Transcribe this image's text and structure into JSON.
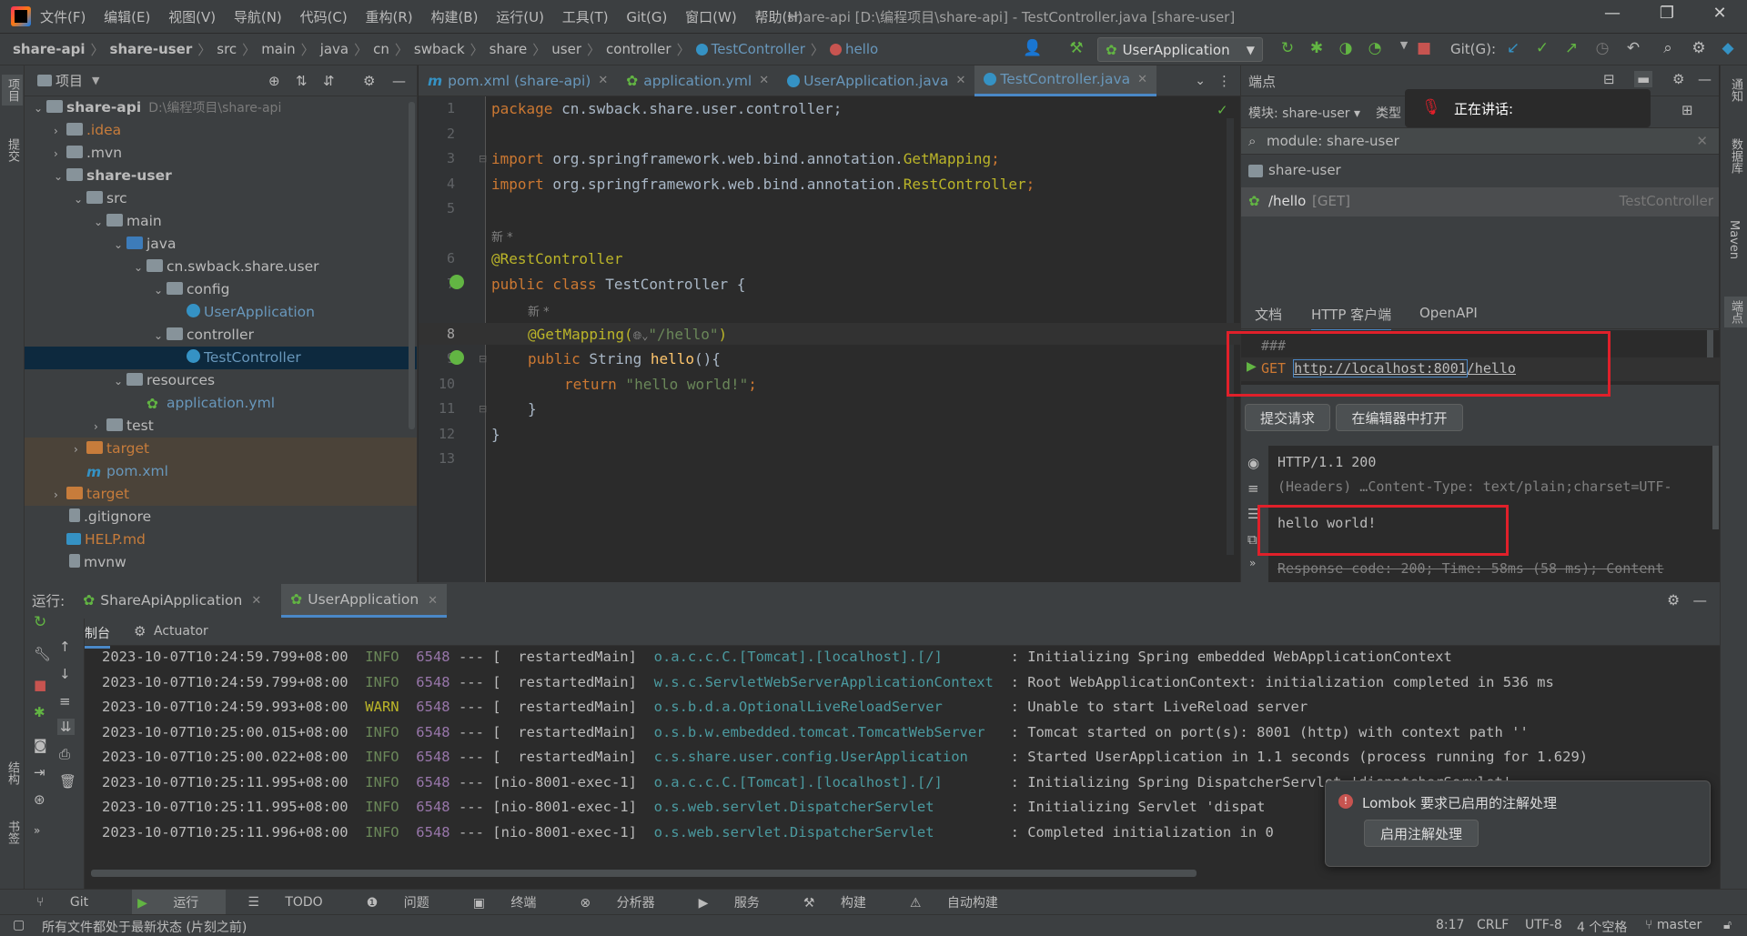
{
  "titlebar": {
    "menus": [
      "文件(F)",
      "编辑(E)",
      "视图(V)",
      "导航(N)",
      "代码(C)",
      "重构(R)",
      "构建(B)",
      "运行(U)",
      "工具(T)",
      "Git(G)",
      "窗口(W)",
      "帮助(H)"
    ],
    "title": "share-api [D:\\编程项目\\share-api] - TestController.java [share-user]"
  },
  "breadcrumbs": [
    "share-api",
    "share-user",
    "src",
    "main",
    "java",
    "cn",
    "swback",
    "share",
    "user",
    "controller",
    "TestController",
    "hello"
  ],
  "toolbar": {
    "run_config": "UserApplication",
    "git_label": "Git(G):"
  },
  "left_strip": {
    "project": "项目",
    "commit": "提交",
    "structure": "结构",
    "bookmarks": "书签"
  },
  "project": {
    "title": "项目",
    "tree": [
      {
        "label": "share-api",
        "hint": "D:\\编程项目\\share-api",
        "depth": 0,
        "arrow": "v",
        "icon": "folder",
        "bold": true
      },
      {
        "label": ".idea",
        "depth": 1,
        "arrow": ">",
        "icon": "folder",
        "color": "#c77c3b"
      },
      {
        "label": ".mvn",
        "depth": 1,
        "arrow": ">",
        "icon": "folder"
      },
      {
        "label": "share-user",
        "depth": 1,
        "arrow": "v",
        "icon": "folder",
        "bold": true
      },
      {
        "label": "src",
        "depth": 2,
        "arrow": "v",
        "icon": "folder"
      },
      {
        "label": "main",
        "depth": 3,
        "arrow": "v",
        "icon": "folder"
      },
      {
        "label": "java",
        "depth": 4,
        "arrow": "v",
        "icon": "folder-blue"
      },
      {
        "label": "cn.swback.share.user",
        "depth": 5,
        "arrow": "v",
        "icon": "folder"
      },
      {
        "label": "config",
        "depth": 6,
        "arrow": "v",
        "icon": "folder"
      },
      {
        "label": "UserApplication",
        "depth": 7,
        "arrow": "",
        "icon": "spring-class",
        "color": "#6897bb"
      },
      {
        "label": "controller",
        "depth": 6,
        "arrow": "v",
        "icon": "folder"
      },
      {
        "label": "TestController",
        "depth": 7,
        "arrow": "",
        "icon": "class",
        "color": "#6897bb",
        "selected": true
      },
      {
        "label": "resources",
        "depth": 4,
        "arrow": "v",
        "icon": "folder"
      },
      {
        "label": "application.yml",
        "depth": 5,
        "arrow": "",
        "icon": "yml",
        "color": "#6897bb"
      },
      {
        "label": "test",
        "depth": 3,
        "arrow": ">",
        "icon": "folder"
      },
      {
        "label": "target",
        "depth": 2,
        "arrow": ">",
        "icon": "folder-orange",
        "color": "#c77c3b",
        "excluded": true
      },
      {
        "label": "pom.xml",
        "depth": 2,
        "arrow": "",
        "icon": "maven",
        "color": "#6897bb",
        "excluded": true
      },
      {
        "label": "target",
        "depth": 1,
        "arrow": ">",
        "icon": "folder-orange",
        "color": "#c77c3b",
        "excluded": true
      },
      {
        "label": ".gitignore",
        "depth": 1,
        "arrow": "",
        "icon": "file"
      },
      {
        "label": "HELP.md",
        "depth": 1,
        "arrow": "",
        "icon": "md",
        "color": "#c77c3b"
      },
      {
        "label": "mvnw",
        "depth": 1,
        "arrow": "",
        "icon": "file"
      }
    ]
  },
  "tabs": [
    {
      "label": "pom.xml (share-api)",
      "icon": "maven"
    },
    {
      "label": "application.yml",
      "icon": "yml"
    },
    {
      "label": "UserApplication.java",
      "icon": "spring-class"
    },
    {
      "label": "TestController.java",
      "icon": "class",
      "active": true
    }
  ],
  "editor": {
    "lines": [
      "1",
      "2",
      "3",
      "4",
      "5",
      "6",
      "7",
      "8",
      "9",
      "10",
      "11",
      "12",
      "13"
    ],
    "hint_new": "新 *",
    "code": {
      "l1_kw": "package",
      "l1_rest": " cn.swback.share.user.controller;",
      "l3_kw": "import",
      "l3_pkg": " org.springframework.web.bind.annotation.",
      "l3_cls": "GetMapping",
      "l3_end": ";",
      "l4_kw": "import",
      "l4_pkg": " org.springframework.web.bind.annotation.",
      "l4_cls": "RestController",
      "l4_end": ";",
      "l6": "@RestController",
      "l7_kw": "public class",
      "l7_rest": " TestController {",
      "l8_ann": "@GetMapping(",
      "l8_str": "\"/hello\"",
      "l8_end": ")",
      "l9_kw": "public",
      "l9_type": " String ",
      "l9_fn": "hello",
      "l9_end": "(){",
      "l10_kw": "return",
      "l10_str": " \"hello world!\"",
      "l10_end": ";",
      "l11": "}",
      "l12": "}"
    }
  },
  "endpoints": {
    "title": "端点",
    "module_filter": "模块: share-user",
    "type_filter": "类型",
    "search_value": "module: share-user",
    "module_item": "share-user",
    "endpoint_path": "/hello",
    "endpoint_method": "[GET]",
    "endpoint_class": "TestController",
    "tabs": [
      "文档",
      "HTTP 客户端",
      "OpenAPI"
    ],
    "http_comment": "###",
    "http_method": "GET",
    "http_host": "http://localhost:8001",
    "http_path": "/hello",
    "submit_button": "提交请求",
    "open_editor_button": "在编辑器中打开",
    "response_status": "HTTP/1.1 200",
    "response_headers": "(Headers) …Content-Type: text/plain;charset=UTF-",
    "response_body": "hello world!",
    "response_footer": "Response code: 200; Time: 58ms (58 ms); Content"
  },
  "speaking_popup": {
    "label": "正在讲话:"
  },
  "run": {
    "label": "运行:",
    "tabs": [
      "ShareApiApplication",
      "UserApplication"
    ],
    "subtabs": [
      "控制台",
      "Actuator"
    ],
    "log": [
      {
        "ts": "2023-10-07T10:24:59.799+08:00",
        "level": "INFO",
        "pid": "6548",
        "thread": "[  restartedMain]",
        "logger": "o.a.c.c.C.[Tomcat].[localhost].[/]      ",
        "msg": ": Initializing Spring embedded WebApplicationContext"
      },
      {
        "ts": "2023-10-07T10:24:59.799+08:00",
        "level": "INFO",
        "pid": "6548",
        "thread": "[  restartedMain]",
        "logger": "w.s.c.ServletWebServerApplicationContext",
        "msg": ": Root WebApplicationContext: initialization completed in 536 ms"
      },
      {
        "ts": "2023-10-07T10:24:59.993+08:00",
        "level": "WARN",
        "pid": "6548",
        "thread": "[  restartedMain]",
        "logger": "o.s.b.d.a.OptionalLiveReloadServer      ",
        "msg": ": Unable to start LiveReload server"
      },
      {
        "ts": "2023-10-07T10:25:00.015+08:00",
        "level": "INFO",
        "pid": "6548",
        "thread": "[  restartedMain]",
        "logger": "o.s.b.w.embedded.tomcat.TomcatWebServer ",
        "msg": ": Tomcat started on port(s): 8001 (http) with context path ''"
      },
      {
        "ts": "2023-10-07T10:25:00.022+08:00",
        "level": "INFO",
        "pid": "6548",
        "thread": "[  restartedMain]",
        "logger": "c.s.share.user.config.UserApplication   ",
        "msg": ": Started UserApplication in 1.1 seconds (process running for 1.629)"
      },
      {
        "ts": "2023-10-07T10:25:11.995+08:00",
        "level": "INFO",
        "pid": "6548",
        "thread": "[nio-8001-exec-1]",
        "logger": "o.a.c.c.C.[Tomcat].[localhost].[/]      ",
        "msg": ": Initializing Spring DispatcherServlet 'dispatcherServlet'"
      },
      {
        "ts": "2023-10-07T10:25:11.995+08:00",
        "level": "INFO",
        "pid": "6548",
        "thread": "[nio-8001-exec-1]",
        "logger": "o.s.web.servlet.DispatcherServlet       ",
        "msg": ": Initializing Servlet 'dispat"
      },
      {
        "ts": "2023-10-07T10:25:11.996+08:00",
        "level": "INFO",
        "pid": "6548",
        "thread": "[nio-8001-exec-1]",
        "logger": "o.s.web.servlet.DispatcherServlet       ",
        "msg": ": Completed initialization in 0"
      }
    ]
  },
  "lombok_popup": {
    "message": "Lombok 要求已启用的注解处理",
    "button": "启用注解处理"
  },
  "bottom_tools": [
    "Git",
    "运行",
    "TODO",
    "问题",
    "终端",
    "分析器",
    "服务",
    "构建",
    "自动构建"
  ],
  "statusbar": {
    "message": "所有文件都处于最新状态 (片刻之前)",
    "position": "8:17",
    "line_sep": "CRLF",
    "encoding": "UTF-8",
    "indent": "4 个空格",
    "branch": "master"
  },
  "right_strip": {
    "notifications": "通知",
    "database": "数据库",
    "maven": "Maven",
    "endpoints": "端点"
  },
  "colors": {
    "accent": "#4a88c7",
    "red_highlight": "#e0202a",
    "keyword": "#cc7832",
    "annotation": "#bbb529",
    "string": "#6a8759"
  }
}
